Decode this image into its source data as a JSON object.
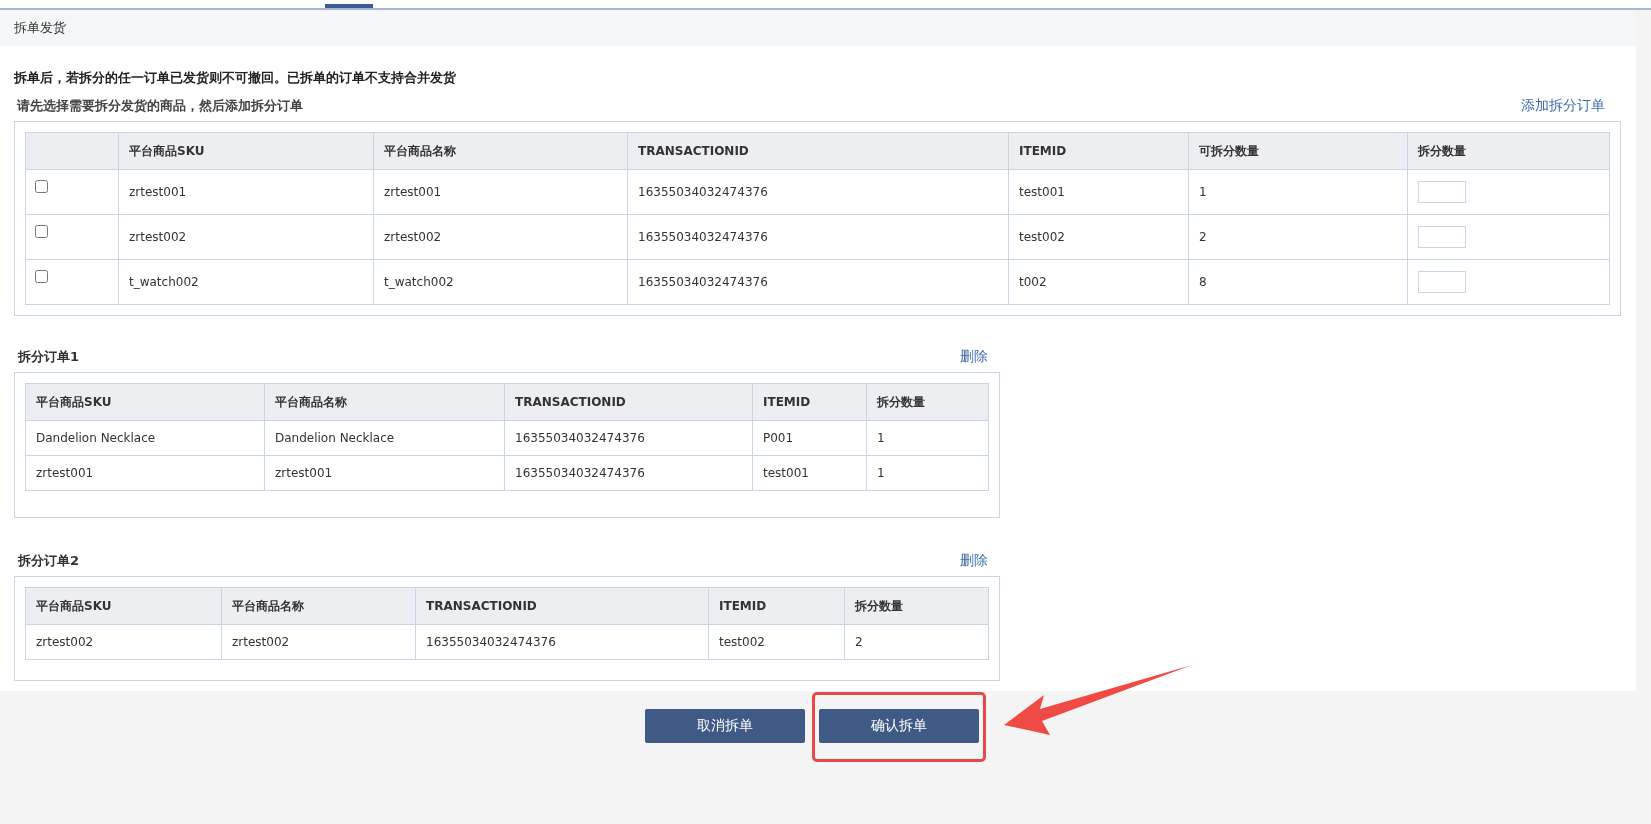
{
  "panel_title": "拆单发货",
  "warning": "拆单后，若拆分的任一订单已发货则不可撤回。已拆单的订单不支持合并发货",
  "instruction": "请先选择需要拆分发货的商品，然后添加拆分订单",
  "add_link": "添加拆分订单",
  "items_table": {
    "columns": [
      "平台商品SKU",
      "平台商品名称",
      "TRANSACTIONID",
      "ITEMID",
      "可拆分数量",
      "拆分数量"
    ],
    "rows": [
      {
        "checked": false,
        "cells": [
          "zrtest001",
          "zrtest001",
          "16355034032474376",
          "test001",
          "1"
        ]
      },
      {
        "checked": false,
        "cells": [
          "zrtest002",
          "zrtest002",
          "16355034032474376",
          "test002",
          "2"
        ]
      },
      {
        "checked": false,
        "cells": [
          "t_watch002",
          "t_watch002",
          "16355034032474376",
          "t002",
          "8"
        ]
      }
    ]
  },
  "split_orders": [
    {
      "title": "拆分订单1",
      "delete_label": "删除",
      "columns": [
        "平台商品SKU",
        "平台商品名称",
        "TRANSACTIONID",
        "ITEMID",
        "拆分数量"
      ],
      "rows": [
        [
          "Dandelion Necklace",
          "Dandelion Necklace",
          "16355034032474376",
          "P001",
          "1"
        ],
        [
          "zrtest001",
          "zrtest001",
          "16355034032474376",
          "test001",
          "1"
        ]
      ]
    },
    {
      "title": "拆分订单2",
      "delete_label": "删除",
      "columns": [
        "平台商品SKU",
        "平台商品名称",
        "TRANSACTIONID",
        "ITEMID",
        "拆分数量"
      ],
      "rows": [
        [
          "zrtest002",
          "zrtest002",
          "16355034032474376",
          "test002",
          "2"
        ]
      ]
    }
  ],
  "buttons": [
    {
      "label": "取消拆单",
      "highlighted": false
    },
    {
      "label": "确认拆单",
      "highlighted": true
    }
  ]
}
